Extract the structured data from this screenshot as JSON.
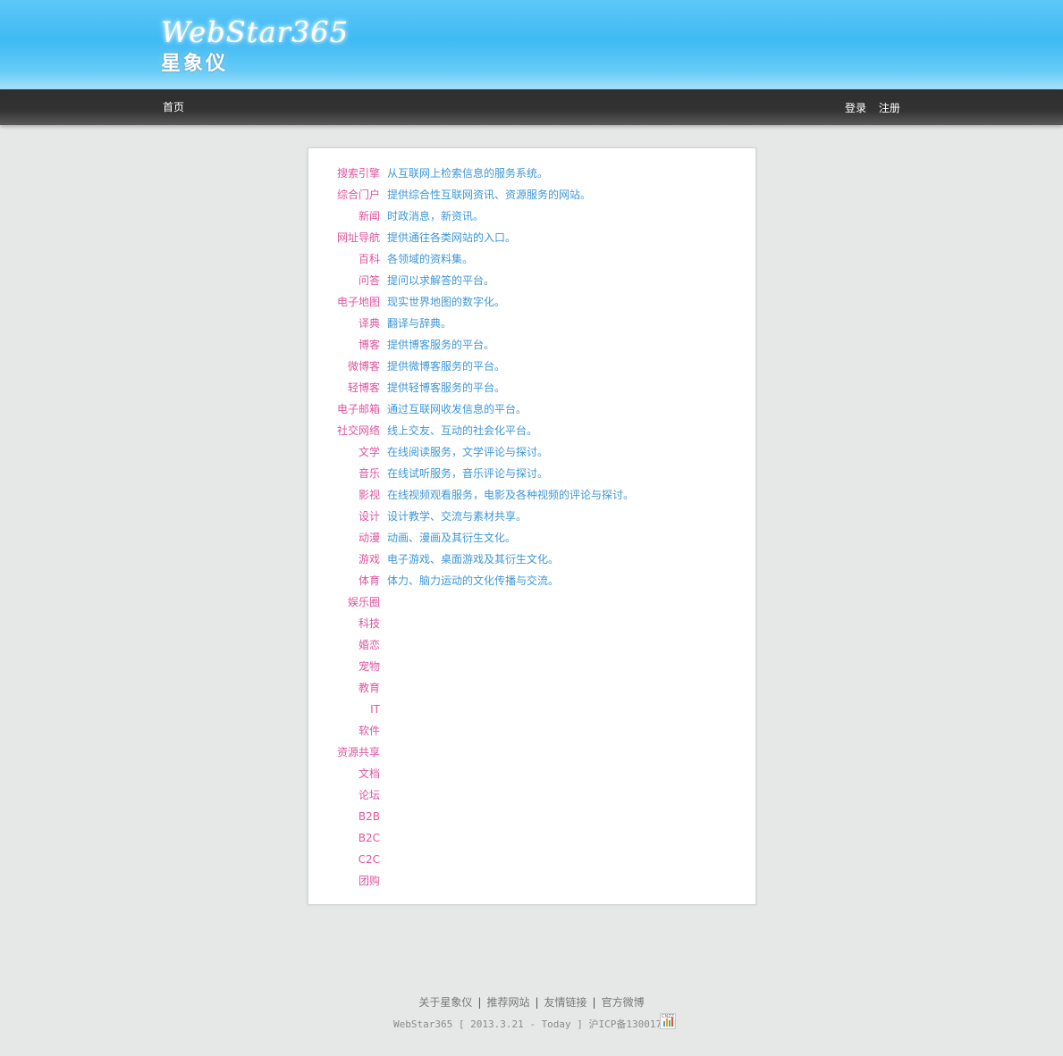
{
  "header": {
    "logo_en": "WebStar365",
    "logo_cn": "星象仪"
  },
  "nav": {
    "home": "首页",
    "login": "登录",
    "register": "注册"
  },
  "categories": [
    {
      "name": "搜索引擎",
      "desc": "从互联网上检索信息的服务系统。"
    },
    {
      "name": "综合门户",
      "desc": "提供综合性互联网资讯、资源服务的网站。"
    },
    {
      "name": "新闻",
      "desc": "时政消息，新资讯。"
    },
    {
      "name": "网址导航",
      "desc": "提供通往各类网站的入口。"
    },
    {
      "name": "百科",
      "desc": "各领域的资料集。"
    },
    {
      "name": "问答",
      "desc": "提问以求解答的平台。"
    },
    {
      "name": "电子地图",
      "desc": "现实世界地图的数字化。"
    },
    {
      "name": "译典",
      "desc": "翻译与辞典。"
    },
    {
      "name": "博客",
      "desc": "提供博客服务的平台。"
    },
    {
      "name": "微博客",
      "desc": "提供微博客服务的平台。"
    },
    {
      "name": "轻博客",
      "desc": "提供轻博客服务的平台。"
    },
    {
      "name": "电子邮箱",
      "desc": "通过互联网收发信息的平台。"
    },
    {
      "name": "社交网络",
      "desc": "线上交友、互动的社会化平台。"
    },
    {
      "name": "文学",
      "desc": "在线阅读服务，文学评论与探讨。"
    },
    {
      "name": "音乐",
      "desc": "在线试听服务，音乐评论与探讨。"
    },
    {
      "name": "影视",
      "desc": "在线视频观看服务，电影及各种视频的评论与探讨。"
    },
    {
      "name": "设计",
      "desc": "设计教学、交流与素材共享。"
    },
    {
      "name": "动漫",
      "desc": "动画、漫画及其衍生文化。"
    },
    {
      "name": "游戏",
      "desc": "电子游戏、桌面游戏及其衍生文化。"
    },
    {
      "name": "体育",
      "desc": "体力、脑力运动的文化传播与交流。"
    },
    {
      "name": "娱乐圈",
      "desc": ""
    },
    {
      "name": "科技",
      "desc": ""
    },
    {
      "name": "婚恋",
      "desc": ""
    },
    {
      "name": "宠物",
      "desc": ""
    },
    {
      "name": "教育",
      "desc": ""
    },
    {
      "name": "IT",
      "desc": ""
    },
    {
      "name": "软件",
      "desc": ""
    },
    {
      "name": "资源共享",
      "desc": ""
    },
    {
      "name": "文档",
      "desc": ""
    },
    {
      "name": "论坛",
      "desc": ""
    },
    {
      "name": "B2B",
      "desc": ""
    },
    {
      "name": "B2C",
      "desc": ""
    },
    {
      "name": "C2C",
      "desc": ""
    },
    {
      "name": "团购",
      "desc": ""
    }
  ],
  "footer": {
    "links": [
      "关于星象仪",
      "推荐网站",
      "友情链接",
      "官方微博"
    ],
    "copyright": "WebStar365 [ 2013.3.21 - Today ] 沪ICP备13001734",
    "badge_text": "CNZZ"
  },
  "colors": {
    "header_blue": "#3fbaf4",
    "navbar": "#2e2e2e",
    "category_pink": "#e0559c",
    "desc_blue": "#3e97d8",
    "background": "#e6e8e8"
  }
}
